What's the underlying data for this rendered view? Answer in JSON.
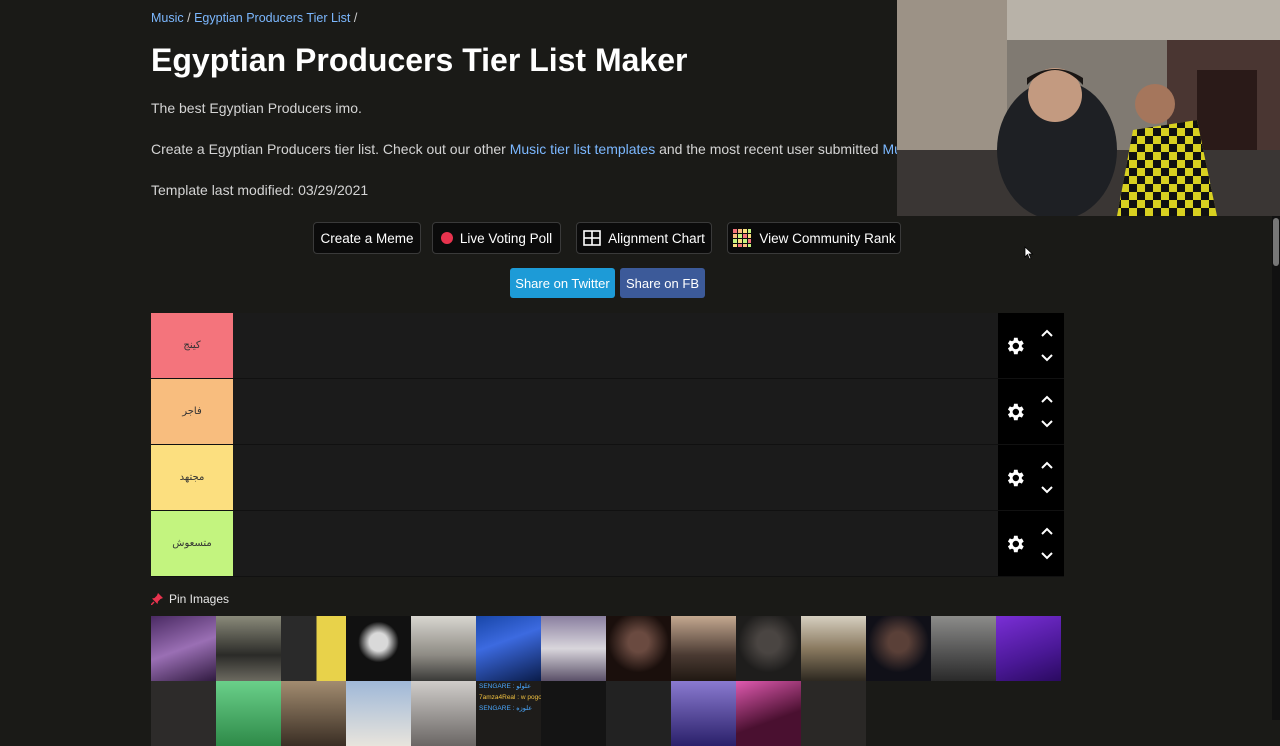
{
  "breadcrumb": {
    "music": "Music",
    "sep1": " / ",
    "list": "Egyptian Producers Tier List",
    "sep2": " /"
  },
  "title": "Egyptian Producers Tier List Maker",
  "description": "The best Egyptian Producers imo.",
  "intro": {
    "prefix": "Create a Egyptian Producers tier list. Check out our other ",
    "link1": "Music tier list templates",
    "middle": " and the most recent user submitted ",
    "link2": "Mus"
  },
  "modified": "Template last modified: 03/29/2021",
  "buttons": {
    "meme": "Create a Meme",
    "poll": "Live Voting Poll",
    "alignment": "Alignment Chart",
    "community": "View Community Rank"
  },
  "share": {
    "twitter": "Share on Twitter",
    "fb": "Share on FB"
  },
  "tiers": [
    {
      "label": "كينج",
      "color": "#f4747c"
    },
    {
      "label": "فاجر",
      "color": "#f8bd7e"
    },
    {
      "label": "مجتهد",
      "color": "#fcdf7f"
    },
    {
      "label": "متسعوش",
      "color": "#c3f47f"
    }
  ],
  "pin_label": "Pin Images",
  "colors": {
    "twitter": "#1d9bd7",
    "fb": "#3c5a99",
    "accent_link": "#7cb8ff",
    "record": "#e8334e"
  },
  "chat_overlay": {
    "line1": "SENGARE : علولو",
    "line2": "7amza4Real : w pogooooooooo",
    "line3": "SENGARE : علوزه"
  }
}
